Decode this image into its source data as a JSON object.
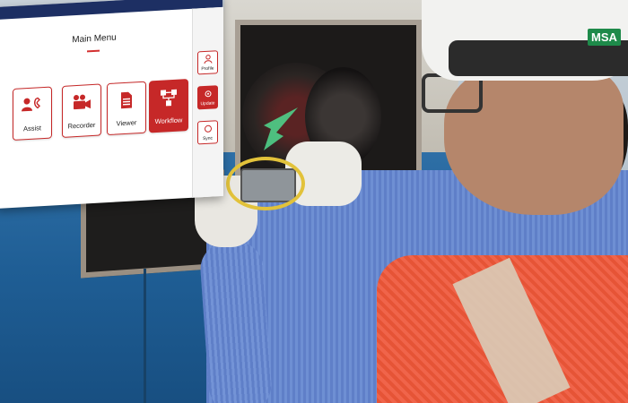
{
  "tablet": {
    "menu_title": "Main Menu",
    "tiles": [
      {
        "label": "Assist",
        "icon": "person-phone-icon",
        "active": false
      },
      {
        "label": "Recorder",
        "icon": "video-camera-icon",
        "active": false
      },
      {
        "label": "Viewer",
        "icon": "document-icon",
        "active": false
      },
      {
        "label": "Workflow",
        "icon": "workflow-icon",
        "active": true
      }
    ],
    "sidebar": [
      {
        "label": "Profile",
        "icon": "profile-icon",
        "active": false
      },
      {
        "label": "Update",
        "icon": "update-icon",
        "active": true
      },
      {
        "label": "Sync",
        "icon": "sync-icon",
        "active": false
      }
    ]
  },
  "colors": {
    "accent_red": "#c62828",
    "topbar_navy": "#1d2f63",
    "highlight_yellow": "#e2c23a",
    "arrow_green": "#4fd08a"
  },
  "helmet_brand": "MSA"
}
